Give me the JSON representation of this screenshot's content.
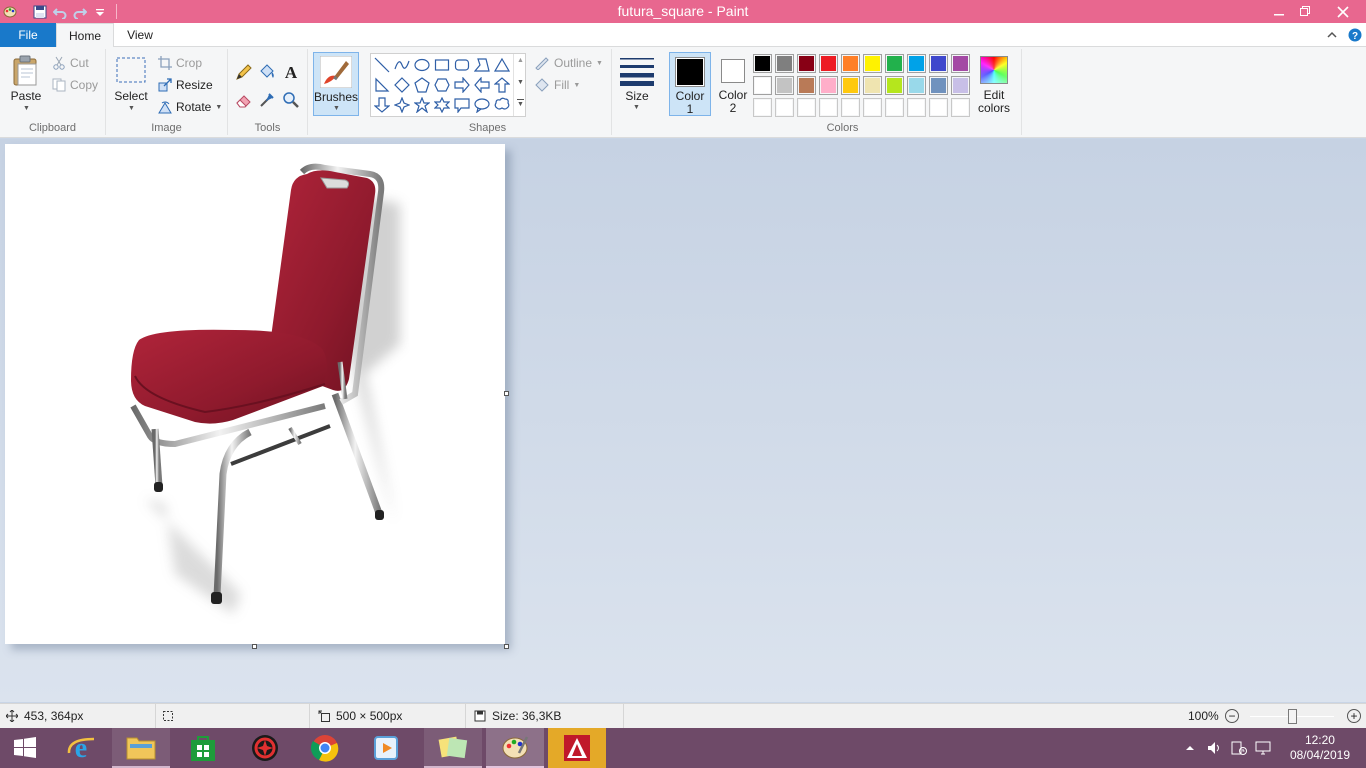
{
  "window": {
    "title": "futura_square - Paint",
    "titlebar_color": "#e8678f"
  },
  "tabs": {
    "file": "File",
    "home": "Home",
    "view": "View"
  },
  "clipboard": {
    "paste": "Paste",
    "cut": "Cut",
    "copy": "Copy",
    "group": "Clipboard"
  },
  "image": {
    "select": "Select",
    "crop": "Crop",
    "resize": "Resize",
    "rotate": "Rotate",
    "group": "Image"
  },
  "tools": {
    "group": "Tools"
  },
  "brushes": {
    "label": "Brushes"
  },
  "shapes": {
    "group": "Shapes",
    "outline": "Outline",
    "fill": "Fill"
  },
  "size": {
    "label": "Size"
  },
  "colors": {
    "color1_line1": "Color",
    "color1_line2": "1",
    "color2_line1": "Color",
    "color2_line2": "2",
    "edit_line1": "Edit",
    "edit_line2": "colors",
    "group": "Colors",
    "color1_value": "#000000",
    "color2_value": "#ffffff",
    "palette_row1": [
      "#000000",
      "#7f7f7f",
      "#880015",
      "#ed1c24",
      "#ff7f27",
      "#fff200",
      "#22b14c",
      "#00a2e8",
      "#3f48cc",
      "#a349a4"
    ],
    "palette_row2": [
      "#ffffff",
      "#c3c3c3",
      "#b97a57",
      "#ffaec9",
      "#ffc90e",
      "#efe4b0",
      "#b5e61d",
      "#99d9ea",
      "#7092be",
      "#c8bfe7"
    ],
    "palette_row3": [
      "#ffffff",
      "#ffffff",
      "#ffffff",
      "#ffffff",
      "#ffffff",
      "#ffffff",
      "#ffffff",
      "#ffffff",
      "#ffffff",
      "#ffffff"
    ]
  },
  "status": {
    "cursor_pos": "453, 364px",
    "dimensions": "500 × 500px",
    "file_size": "Size: 36,3KB",
    "zoom": "100%",
    "zoom_fraction": 0.5
  },
  "taskbar": {
    "time": "12:20",
    "date": "08/04/2019",
    "color": "#6e4a68"
  }
}
